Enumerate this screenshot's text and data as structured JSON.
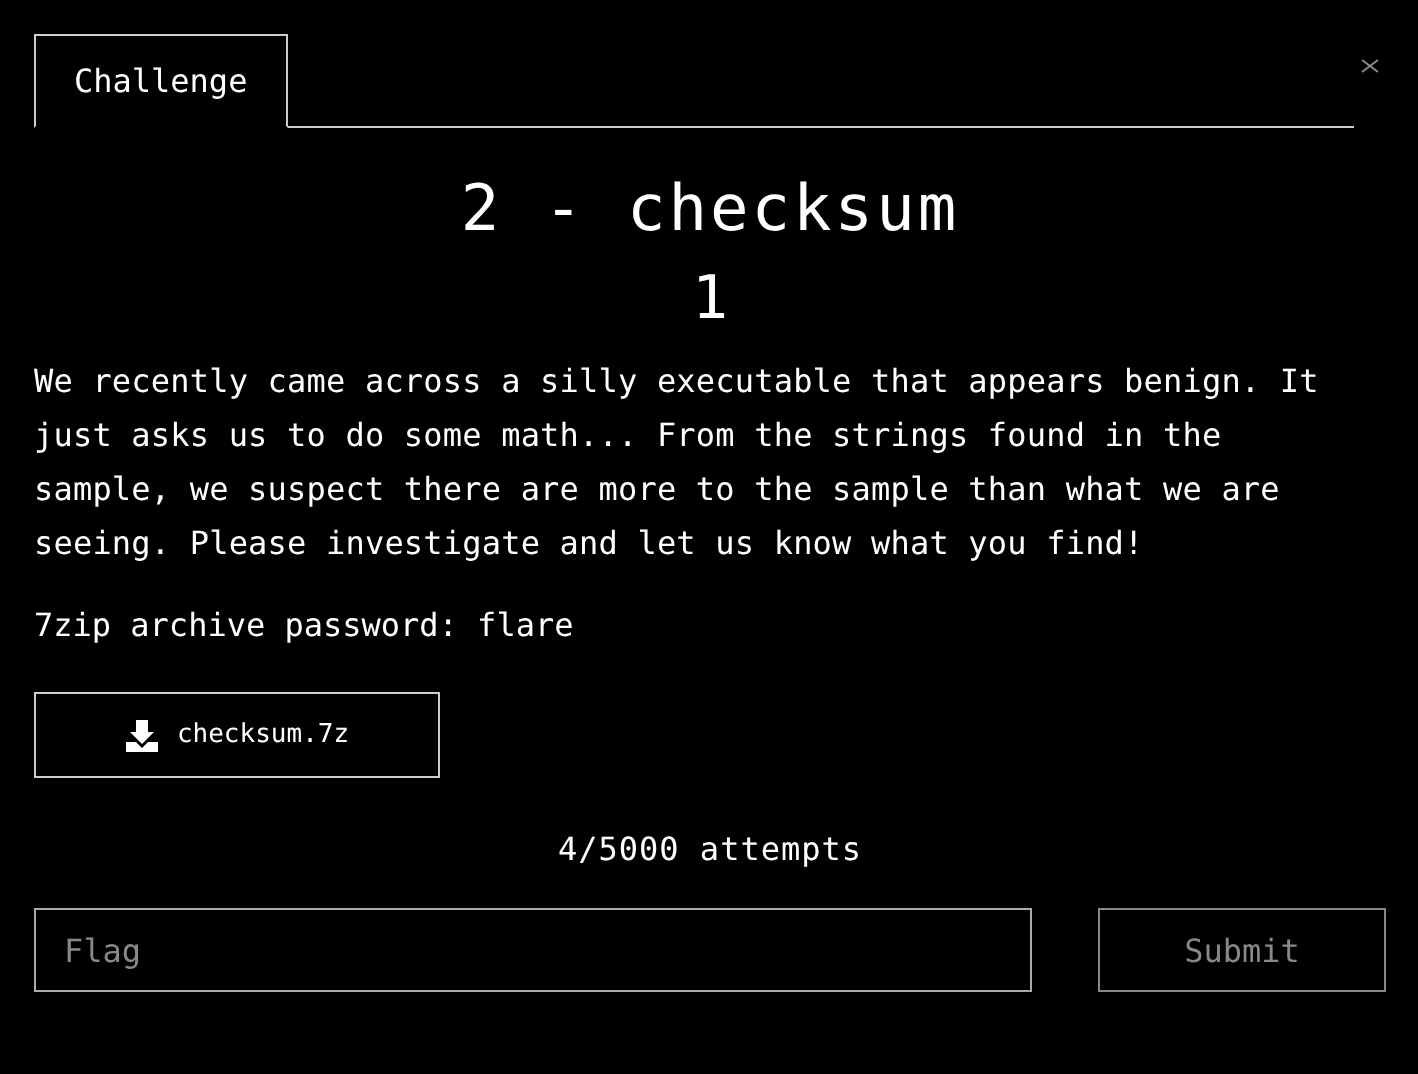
{
  "tabs": [
    {
      "label": "Challenge",
      "selected": true
    }
  ],
  "challenge": {
    "title": "2 - checksum",
    "value": "1",
    "description": "We recently came across a silly executable that appears benign. It just asks us to do some math... From the strings found in the sample, we suspect there are more to the sample than what we are seeing. Please investigate and let us know what you find!",
    "note": "7zip archive password: flare"
  },
  "download": {
    "label": "checksum.7z"
  },
  "attempts": "4/5000 attempts",
  "flag_field": {
    "placeholder": "Flag"
  },
  "submit": {
    "label": "Submit",
    "disabled": true
  }
}
